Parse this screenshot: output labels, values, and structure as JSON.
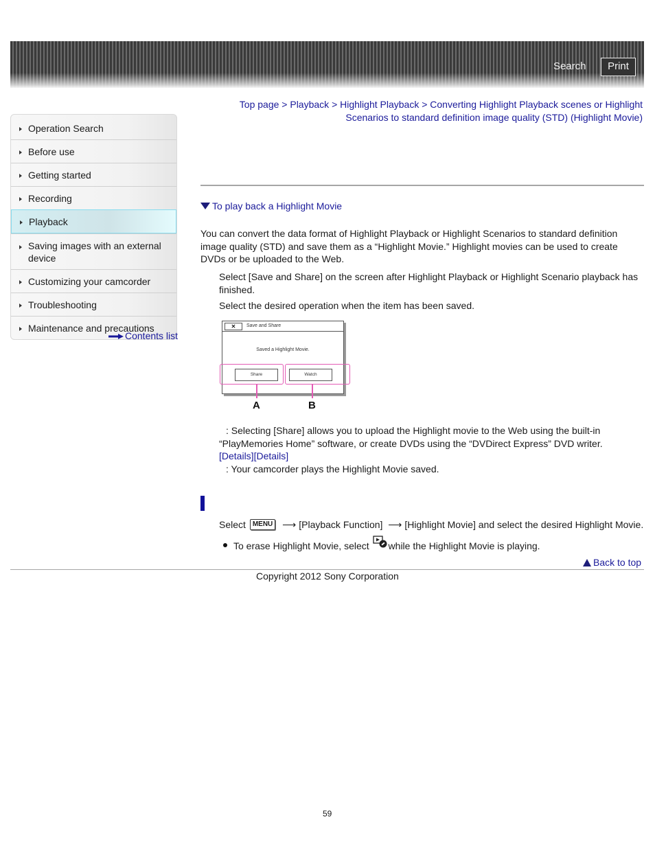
{
  "header": {
    "search_label": "Search",
    "print_label": "Print"
  },
  "sidebar": {
    "items": [
      {
        "label": "Operation Search",
        "active": false
      },
      {
        "label": "Before use",
        "active": false
      },
      {
        "label": "Getting started",
        "active": false
      },
      {
        "label": "Recording",
        "active": false
      },
      {
        "label": "Playback",
        "active": true
      },
      {
        "label": "Saving images with an external device",
        "active": false
      },
      {
        "label": "Customizing your camcorder",
        "active": false
      },
      {
        "label": "Troubleshooting",
        "active": false
      },
      {
        "label": "Maintenance and precautions",
        "active": false
      }
    ],
    "contents_link": "Contents list"
  },
  "breadcrumb": {
    "items": [
      "Top page",
      "Playback",
      "Highlight Playback",
      "Converting Highlight Playback scenes or Highlight Scenarios to standard definition image quality (STD) (Highlight Movie)"
    ],
    "separator": ">"
  },
  "main": {
    "toc_link": "To play back a Highlight Movie",
    "intro": "You can convert the data format of Highlight Playback or Highlight Scenarios to standard definition image quality (STD) and save them as a “Highlight Movie.” Highlight movies can be used to create DVDs or be uploaded to the Web.",
    "steps": [
      "Select [Save and Share] on the screen after Highlight Playback or Highlight Scenario playback has finished.",
      "Select the desired operation when the item has been saved."
    ],
    "illustration": {
      "close_glyph": "✕",
      "title": "Save and Share",
      "message": "Saved a Highlight Movie.",
      "button_a": "Share",
      "button_b": "Watch",
      "label_a": "A",
      "label_b": "B",
      "highlight_color": "#e35bb5"
    },
    "desc_a": ": Selecting [Share] allows you to upload the Highlight movie to the Web using the built-in “PlayMemories Home” software, or create DVDs using the “DVDirect Express” DVD writer.",
    "details_links": [
      "[Details]",
      "[Details]"
    ],
    "desc_b": ": Your camcorder plays the Highlight Movie saved.",
    "playback_section": {
      "select_word": "Select",
      "menu_icon_label": "MENU",
      "arrow_glyph": "⟶",
      "step_part1": "[Playback Function]",
      "step_part2": "[Highlight Movie] and select the desired Highlight Movie.",
      "bullet_before": "To erase Highlight Movie, select",
      "bullet_after": "while the Highlight Movie is playing."
    }
  },
  "footer": {
    "back_to_top": "Back to top",
    "copyright": "Copyright 2012 Sony Corporation",
    "page_number": "59"
  },
  "colors": {
    "link": "#1a1a9a",
    "active_nav_border": "#87dcef",
    "section_bar": "#111199"
  }
}
